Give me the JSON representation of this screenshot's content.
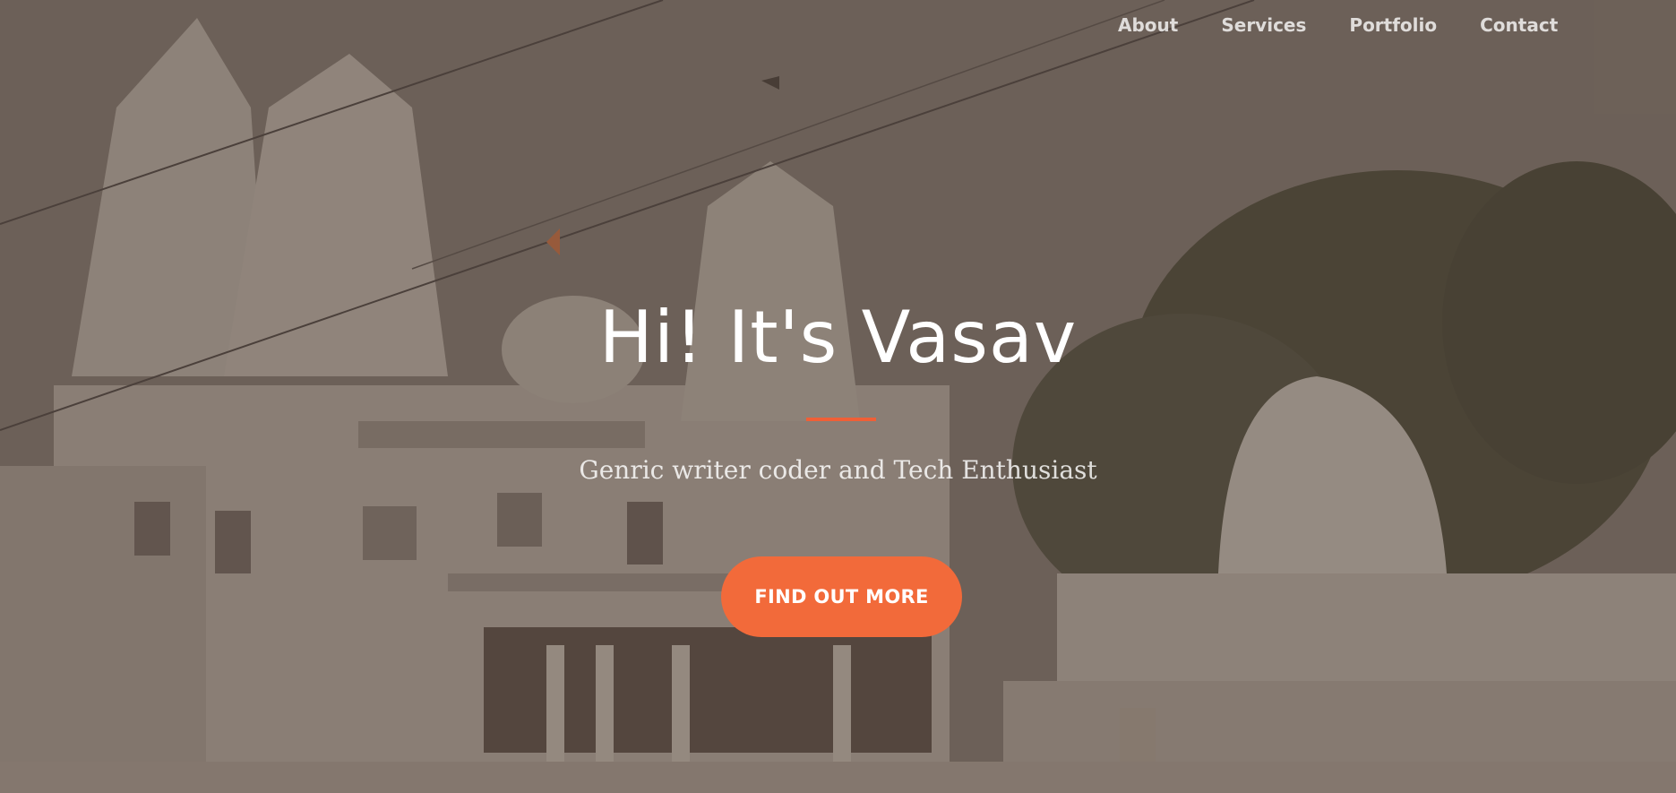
{
  "nav": {
    "items": [
      {
        "label": "About"
      },
      {
        "label": "Services"
      },
      {
        "label": "Portfolio"
      },
      {
        "label": "Contact"
      }
    ]
  },
  "hero": {
    "title": "Hi! It's Vasav",
    "subtitle": "Genric writer coder and Tech Enthusiast",
    "cta_label": "FIND OUT MORE"
  },
  "colors": {
    "accent": "#f05f36",
    "button": "#f26a3a",
    "text": "#ffffff"
  }
}
